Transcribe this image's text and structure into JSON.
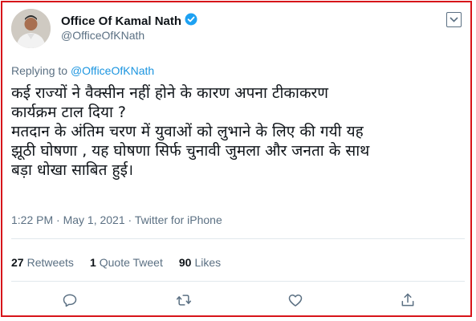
{
  "author": {
    "name": "Office Of Kamal Nath",
    "handle": "@OfficeOfKNath",
    "verified": true
  },
  "reply": {
    "prefix": "Replying to",
    "to": "@OfficeOfKNath"
  },
  "tweet": {
    "lines": [
      "कई राज्यों ने वैक्सीन नहीं होने के कारण अपना टीकाकरण",
      "कार्यक्रम टाल दिया ?",
      "मतदान के अंतिम चरण में  युवाओं को लुभाने के लिए की गयी यह",
      "झूठी घोषणा , यह घोषणा सिर्फ चुनावी जुमला और जनता के साथ",
      "बड़ा धोखा साबित हुई।"
    ]
  },
  "meta": "1:22 PM · May 1, 2021 · Twitter for iPhone",
  "stats": {
    "retweets_count": "27",
    "retweets_label": "Retweets",
    "quotes_count": "1",
    "quotes_label": "Quote Tweet",
    "likes_count": "90",
    "likes_label": "Likes"
  },
  "icons": {
    "verified": "verified-badge-icon",
    "more": "chevron-down-icon",
    "reply": "reply-icon",
    "retweet": "retweet-icon",
    "like": "heart-icon",
    "share": "share-icon"
  },
  "colors": {
    "frame": "#d7141a",
    "link": "#1b95e0",
    "text": "#0f1419",
    "muted": "#5b7083"
  }
}
